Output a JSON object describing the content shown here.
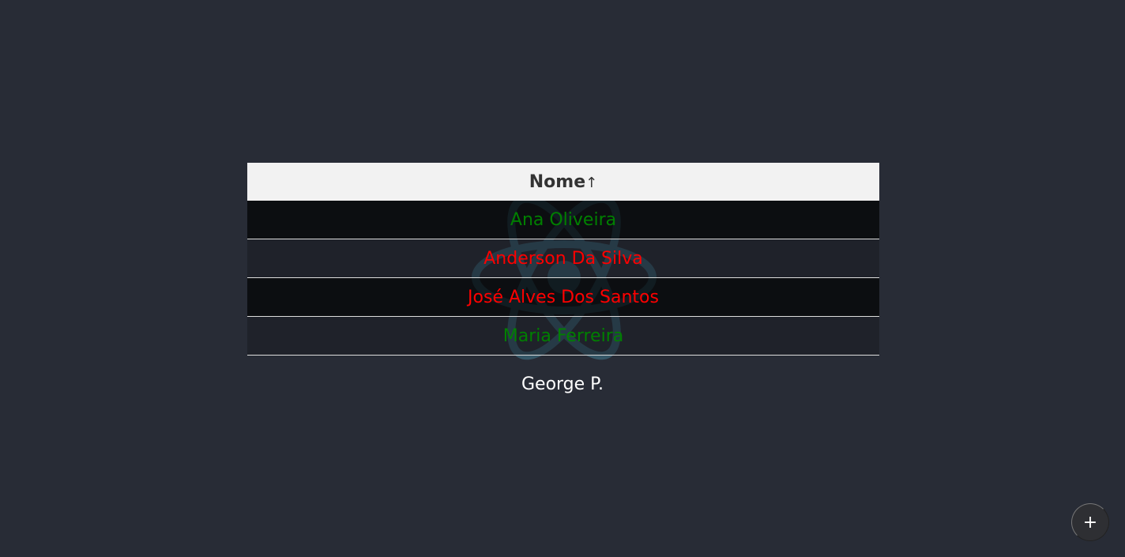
{
  "table": {
    "header": "Nome",
    "sort_indicator": "↑",
    "rows": [
      {
        "name": "Ana Oliveira",
        "color": "#008000"
      },
      {
        "name": "Anderson Da Silva",
        "color": "#ff0000"
      },
      {
        "name": "José Alves Dos Santos",
        "color": "#ff0000"
      },
      {
        "name": "Maria Ferreira",
        "color": "#008000"
      }
    ]
  },
  "signature": "George P.",
  "fab": {
    "icon": "plus-icon",
    "label": "+"
  }
}
